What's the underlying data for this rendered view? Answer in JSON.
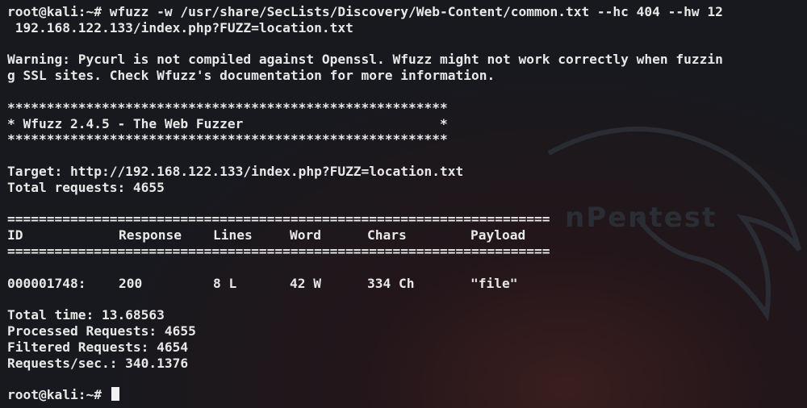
{
  "terminal": {
    "prompt": "root@kali:~#",
    "command_line_1": " wfuzz -w /usr/share/SecLists/Discovery/Web-Content/common.txt --hc 404 --hw 12",
    "command_line_2": " 192.168.122.133/index.php?FUZZ=location.txt",
    "warning_line_1": "Warning: Pycurl is not compiled against Openssl. Wfuzz might not work correctly when fuzzin",
    "warning_line_2": "g SSL sites. Check Wfuzz's documentation for more information.",
    "banner_stars": "********************************************************",
    "banner_title": "* Wfuzz 2.4.5 - The Web Fuzzer                         *",
    "target": "Target: http://192.168.122.133/index.php?FUZZ=location.txt",
    "total_requests": "Total requests: 4655",
    "separator": "=====================================================================",
    "table": {
      "headers": [
        "ID",
        "Response",
        "Lines",
        "Word",
        "Chars",
        "Payload"
      ],
      "rows": [
        [
          "000001748:",
          "200",
          "8 L",
          "42 W",
          "334 Ch",
          "\"file\""
        ]
      ]
    },
    "stats": {
      "total_time": "Total time: 13.68563",
      "processed": "Processed Requests: 4655",
      "filtered": "Filtered Requests: 4654",
      "rate": "Requests/sec.: 340.1376"
    },
    "final_prompt": "root@kali:~#"
  }
}
